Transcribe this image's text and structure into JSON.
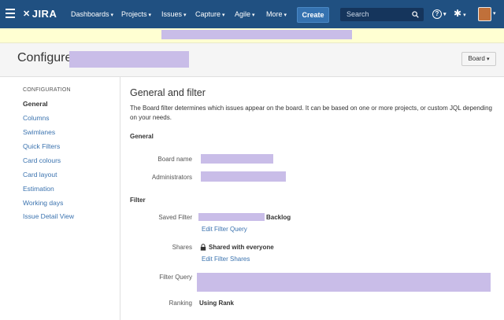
{
  "topnav": {
    "logo": "JIRA",
    "items": [
      {
        "label": "Dashboards"
      },
      {
        "label": "Projects"
      },
      {
        "label": "Issues"
      },
      {
        "label": "Capture"
      },
      {
        "label": "Agile"
      },
      {
        "label": "More"
      }
    ],
    "create_label": "Create",
    "search_placeholder": "Search",
    "help_symbol": "?",
    "gear_symbol": "✱",
    "caret": "▾",
    "brand_color": "#205081"
  },
  "header": {
    "title": "Configure",
    "board_button": "Board"
  },
  "sidebar": {
    "heading": "CONFIGURATION",
    "items": [
      {
        "label": "General",
        "active": true
      },
      {
        "label": "Columns"
      },
      {
        "label": "Swimlanes"
      },
      {
        "label": "Quick Filters"
      },
      {
        "label": "Card colours"
      },
      {
        "label": "Card layout"
      },
      {
        "label": "Estimation"
      },
      {
        "label": "Working days"
      },
      {
        "label": "Issue Detail View"
      }
    ]
  },
  "main": {
    "title": "General and filter",
    "description": "The Board filter determines which issues appear on the board. It can be based on one or more projects, or custom JQL depending on your needs.",
    "general": {
      "heading": "General",
      "board_name_label": "Board name",
      "administrators_label": "Administrators"
    },
    "filter": {
      "heading": "Filter",
      "saved_filter_label": "Saved Filter",
      "saved_filter_suffix": "Backlog",
      "edit_filter_query": "Edit Filter Query",
      "shares_label": "Shares",
      "shares_value": "Shared with everyone",
      "edit_filter_shares": "Edit Filter Shares",
      "filter_query_label": "Filter Query",
      "ranking_label": "Ranking",
      "ranking_value": "Using Rank"
    }
  },
  "colors": {
    "link": "#3b73af",
    "redaction": "#c9bde8",
    "banner": "#ffffd2"
  }
}
